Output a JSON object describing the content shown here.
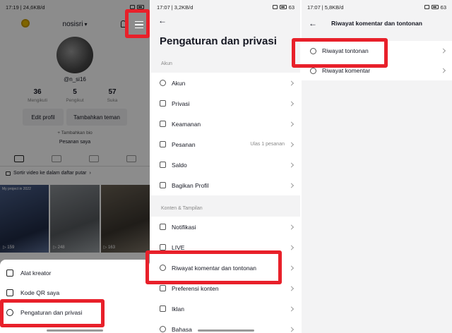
{
  "screens": {
    "profile": {
      "status_time": "17:19",
      "status_speed": "24,6KB/d",
      "username": "nosisri",
      "handle": "@n_si16",
      "stats": [
        {
          "value": "36",
          "label": "Mengikuti"
        },
        {
          "value": "5",
          "label": "Pengikut"
        },
        {
          "value": "57",
          "label": "Suka"
        }
      ],
      "edit_profile": "Edit profil",
      "add_friends": "Tambahkan teman",
      "bio": "+ Tambahkan bio",
      "orders": "Pesanan saya",
      "sort_text": "Sortir video ke dalam daftar putar",
      "videos": [
        {
          "caption": "My project in 2022",
          "views": "159"
        },
        {
          "caption": "",
          "views": "248"
        },
        {
          "caption": "",
          "views": "163"
        }
      ],
      "sheet_items": [
        "Alat kreator",
        "Kode QR saya",
        "Pengaturan dan privasi"
      ]
    },
    "settings": {
      "status_time": "17:07",
      "status_speed": "3,2KB/d",
      "battery": "63",
      "title": "Pengaturan dan privasi",
      "section_account": "Akun",
      "account_items": [
        {
          "label": "Akun",
          "icon": "person-icon"
        },
        {
          "label": "Privasi",
          "icon": "lock-icon"
        },
        {
          "label": "Keamanan",
          "icon": "shield-icon"
        },
        {
          "label": "Pesanan",
          "icon": "bag-icon",
          "extra": "Ulas 1 pesanan"
        },
        {
          "label": "Saldo",
          "icon": "wallet-icon"
        },
        {
          "label": "Bagikan Profil",
          "icon": "share-icon"
        }
      ],
      "section_content": "Konten & Tampilan",
      "content_items": [
        {
          "label": "Notifikasi",
          "icon": "bell-icon"
        },
        {
          "label": "LIVE",
          "icon": "live-icon"
        },
        {
          "label": "Riwayat komentar dan tontonan",
          "icon": "clock-icon"
        },
        {
          "label": "Preferensi konten",
          "icon": "video-icon"
        },
        {
          "label": "Iklan",
          "icon": "megaphone-icon"
        },
        {
          "label": "Bahasa",
          "icon": "globe-icon"
        }
      ]
    },
    "history": {
      "status_time": "17:07",
      "status_speed": "5,8KB/d",
      "battery": "63",
      "title": "Riwayat komentar dan tontonan",
      "items": [
        {
          "label": "Riwayat tontonan",
          "icon": "play-icon"
        },
        {
          "label": "Riwayat komentar",
          "icon": "comment-icon"
        }
      ]
    }
  },
  "colors": {
    "highlight": "#e8202a",
    "background": "#f3f3f4"
  }
}
